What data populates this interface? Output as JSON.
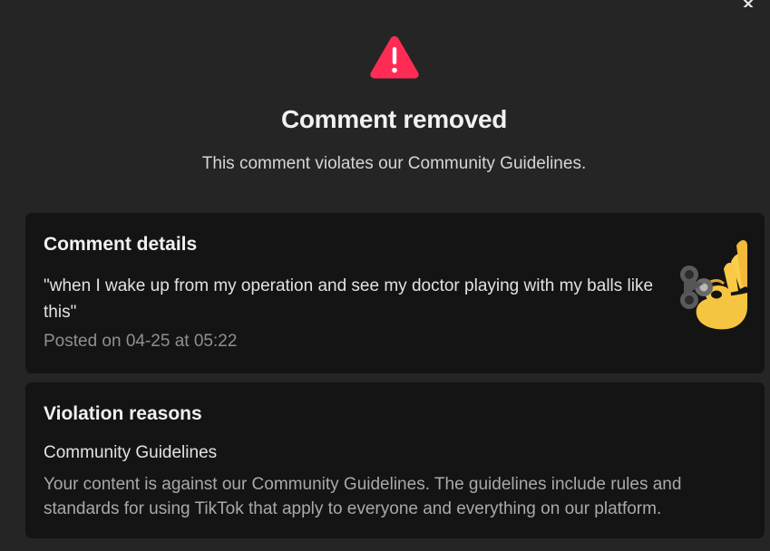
{
  "header": {
    "title": "Comment removed",
    "subtitle": "This comment violates our Community Guidelines.",
    "warning_color": "#fe2c55",
    "icon": "warning-triangle-icon"
  },
  "close": {
    "icon": "close-icon"
  },
  "comment_details": {
    "heading": "Comment details",
    "text": "\"when I wake up from my operation and see my doctor playing with my balls like this\"",
    "posted": "Posted on 04-25 at 05:22",
    "sticker": "ok-hand-fidget-spinner-sticker"
  },
  "violation": {
    "heading": "Violation reasons",
    "reason": "Community Guidelines",
    "description": "Your content is against our Community Guidelines. The guidelines include rules and standards for using TikTok that apply to everyone and everything on our platform."
  }
}
